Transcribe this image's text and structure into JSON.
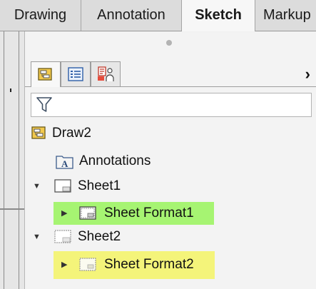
{
  "tabs": [
    {
      "label": "Drawing",
      "active": false
    },
    {
      "label": "Annotation",
      "active": false
    },
    {
      "label": "Sketch",
      "active": true
    },
    {
      "label": "Markup",
      "active": false
    }
  ],
  "panel": {
    "tab_icons": [
      "drawing-tree-icon",
      "property-list-icon",
      "configuration-icon"
    ],
    "overflow_icon": "chevron-right-icon",
    "filter_icon": "funnel-icon"
  },
  "tree": {
    "root": {
      "label": "Draw2",
      "icon": "drawing-icon"
    },
    "items": [
      {
        "label": "Annotations",
        "icon": "annotations-folder-icon"
      },
      {
        "label": "Sheet1",
        "icon": "sheet-icon",
        "expanded": true
      },
      {
        "label": "Sheet Format1",
        "icon": "sheet-format-icon",
        "highlight": "#a6f472"
      },
      {
        "label": "Sheet2",
        "icon": "sheet-icon",
        "expanded": true
      },
      {
        "label": "Sheet Format2",
        "icon": "sheet-format-icon",
        "highlight": "#f4f47a"
      }
    ]
  }
}
